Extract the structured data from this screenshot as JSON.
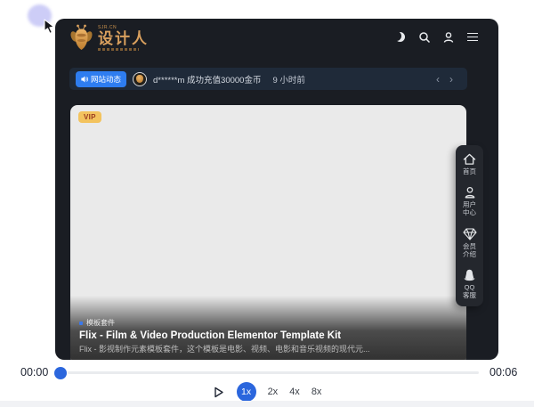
{
  "window": {
    "brand": {
      "domain": "SJR.CN",
      "name": "设计人"
    },
    "notice": {
      "badge": "网站动态",
      "message": "d******m 成功充值30000金币",
      "time": "9 小时前",
      "prev": "‹",
      "next": "›"
    },
    "card": {
      "vip": "VIP",
      "tag": "模板套件",
      "title": "Flix - Film & Video Production Elementor Template Kit",
      "description": "Flix - 影视制作元素模板套件，这个模板是电影、视频、电影和音乐视频的现代元..."
    },
    "sidebar": [
      {
        "icon": "home-icon",
        "label": "首页"
      },
      {
        "icon": "user-icon",
        "label": "用户中心"
      },
      {
        "icon": "diamond-icon",
        "label": "会员介绍"
      },
      {
        "icon": "qq-icon",
        "label": "QQ客服"
      }
    ]
  },
  "player": {
    "current_time": "00:00",
    "duration": "00:06",
    "speeds": [
      "1x",
      "2x",
      "4x",
      "8x"
    ],
    "active_speed": "1x"
  },
  "colors": {
    "accent_blue": "#2e7df0",
    "player_blue": "#2b66dd",
    "brand_gold": "#d9a05e",
    "vip_bg": "#f3c35e",
    "vip_text": "#9a3a20",
    "frame_bg": "#1a1d23",
    "notice_bg": "#1f2a39",
    "card_bg": "#eaeaea",
    "sidebar_bg": "#24272d"
  }
}
